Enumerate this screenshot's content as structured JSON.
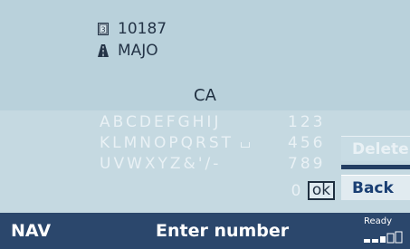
{
  "address": {
    "postal_code": "10187",
    "street": "MAJO",
    "postal_code_icon": "postal-code-icon",
    "street_icon": "street-road-icon"
  },
  "entry": {
    "text": "CA"
  },
  "keypad": {
    "letter_rows": [
      "ABCDEFGHIJ",
      "KLMNOPQRST",
      "UVWXYZ&'/-"
    ],
    "number_rows": [
      "123",
      "456",
      "789"
    ],
    "zero": "0",
    "ok_label": "ok",
    "space_icon": "space-key-icon"
  },
  "buttons": {
    "delete": "Delete",
    "back": "Back"
  },
  "status_bar": {
    "mode": "NAV",
    "title": "Enter number",
    "ready": "Ready",
    "signal_icon": "signal-strength-icon",
    "signal_level": 0.6
  },
  "colors": {
    "screen_bg": "#b7cfd9",
    "status_bg": "#2b476c",
    "active_button_text": "#1a3f73",
    "inactive_text": "#e9f1f5"
  }
}
